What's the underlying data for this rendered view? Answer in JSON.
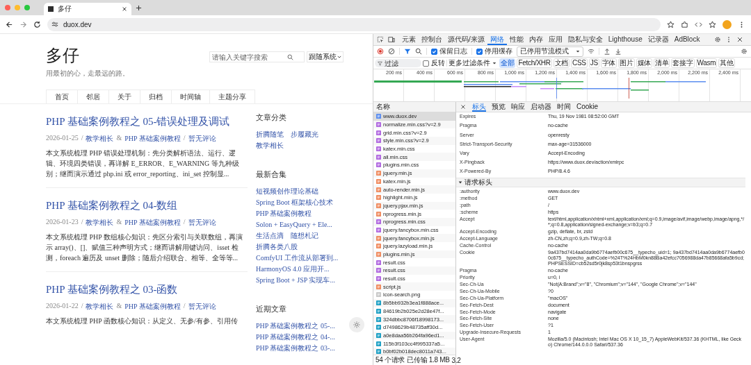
{
  "browser": {
    "tab_title": "多仔",
    "address": "duox.dev"
  },
  "page": {
    "site_title": "多仔",
    "tagline": "用最初的心，走最远的路。",
    "search": {
      "placeholder": "请输入关键字搜索"
    },
    "theme_select": "跟随系统",
    "nav": [
      {
        "label": "首页"
      },
      {
        "label": "邻居"
      },
      {
        "label": "关于"
      },
      {
        "label": "归档"
      },
      {
        "label": "时间轴"
      },
      {
        "label": "主题分享"
      }
    ],
    "meta_separator": "/",
    "category_joiner": "&",
    "posts": [
      {
        "title": "PHP 基础案例教程之 05-错误处理及调试",
        "date": "2026-01-25",
        "categories": [
          "教学相长",
          "PHP 基础案例教程"
        ],
        "comments": "暂无评论",
        "excerpt": "本文系统梳理 PHP 错误处理机制：先分类解析语法、运行、逻辑、环境四类错误，再详解 E_ERROR、E_WARNING 等九种级别；继而演示通过 php.ini 或 error_reporting、ini_set 控制显..."
      },
      {
        "title": "PHP 基础案例教程之 04-数组",
        "date": "2026-01-23",
        "categories": [
          "教学相长",
          "PHP 基础案例教程"
        ],
        "comments": "暂无评论",
        "excerpt": "本文系统梳理 PHP 数组核心知识：先区分索引与关联数组，再演示 array()、[]、赋值三种声明方式；继而讲解用键访问、isset 检测，foreach 遍历及 unset 删除；随后介绍联合、相等、全等等..."
      },
      {
        "title": "PHP 基础案例教程之 03-函数",
        "date": "2026-01-22",
        "categories": [
          "教学相长",
          "PHP 基础案例教程"
        ],
        "comments": "暂无评论",
        "excerpt": "本文系统梳理 PHP 函数核心知识：从定义、无参/有参、引用传"
      }
    ],
    "sidebar": [
      {
        "heading": "文章分类",
        "rows": [
          [
            "折腾随笔",
            "步履藏光"
          ],
          [
            "教学相长"
          ]
        ]
      },
      {
        "heading": "最新合集",
        "rows": [
          [
            "短视频创作理论基础"
          ],
          [
            "Spring Boot 框架核心技术"
          ],
          [
            "PHP 基础案例教程"
          ],
          [
            "Solon + EasyQuery + Ele..."
          ],
          [
            "生活点滴",
            "随想札记"
          ],
          [
            "折腾各类八股"
          ],
          [
            "ComfyUI 工作流从部署到..."
          ],
          [
            "HarmonyOS 4.0 应用开..."
          ],
          [
            "Spring Boot + JSP 实现车..."
          ]
        ]
      },
      {
        "heading": "近期文章",
        "rows": [
          [
            "PHP 基础案例教程之 05-..."
          ],
          [
            "PHP 基础案例教程之 04-..."
          ],
          [
            "PHP 基础案例教程之 03-..."
          ]
        ]
      }
    ]
  },
  "devtools": {
    "panels": [
      {
        "label": "元素",
        "selected": false
      },
      {
        "label": "控制台",
        "selected": false
      },
      {
        "label": "源代码/来源",
        "selected": false
      },
      {
        "label": "网络",
        "selected": true
      },
      {
        "label": "性能",
        "selected": false
      },
      {
        "label": "内存",
        "selected": false
      },
      {
        "label": "应用",
        "selected": false
      },
      {
        "label": "隐私与安全",
        "selected": false
      },
      {
        "label": "Lighthouse",
        "selected": false
      },
      {
        "label": "记录器",
        "selected": false
      },
      {
        "label": "AdBlock",
        "selected": false
      }
    ],
    "toolbar": {
      "preserve_log": {
        "label": "保留日志",
        "checked": true
      },
      "disable_cache": {
        "label": "停用缓存",
        "checked": true
      },
      "throttle": "已停用节流模式"
    },
    "filter": {
      "placeholder": "过滤",
      "invert": {
        "label": "反转",
        "checked": false
      },
      "more_filters": "更多过滤条件",
      "types": [
        {
          "label": "全部",
          "selected": true
        },
        {
          "label": "Fetch/XHR",
          "selected": false
        },
        {
          "label": "文档",
          "selected": false
        },
        {
          "label": "CSS",
          "selected": false
        },
        {
          "label": "JS",
          "selected": false
        },
        {
          "label": "字体",
          "selected": false
        },
        {
          "label": "图片",
          "selected": false
        },
        {
          "label": "媒体",
          "selected": false
        },
        {
          "label": "清单",
          "selected": false
        },
        {
          "label": "套接字",
          "selected": false
        },
        {
          "label": "Wasm",
          "selected": false
        },
        {
          "label": "其他",
          "selected": false
        }
      ]
    },
    "timeline_ticks": [
      "200 ms",
      "400 ms",
      "600 ms",
      "800 ms",
      "1,000 ms",
      "1,200 ms",
      "1,400 ms",
      "1,600 ms",
      "1,800 ms",
      "2,000 ms",
      "2,200 ms",
      "2,400 ms"
    ],
    "requests": {
      "header": "名称",
      "items": [
        {
          "name": "www.duox.dev",
          "kind": "document",
          "selected": true
        },
        {
          "name": "normalize.min.css?v=2.9",
          "kind": "stylesheet",
          "selected": false
        },
        {
          "name": "grid.min.css?v=2.9",
          "kind": "stylesheet",
          "selected": false
        },
        {
          "name": "style.min.css?v=2.9",
          "kind": "stylesheet",
          "selected": false
        },
        {
          "name": "katex.min.css",
          "kind": "stylesheet",
          "selected": false
        },
        {
          "name": "all.min.css",
          "kind": "stylesheet",
          "selected": false
        },
        {
          "name": "plugins.min.css",
          "kind": "stylesheet",
          "selected": false
        },
        {
          "name": "jquery.min.js",
          "kind": "script",
          "selected": false
        },
        {
          "name": "katex.min.js",
          "kind": "script",
          "selected": false
        },
        {
          "name": "auto-render.min.js",
          "kind": "script",
          "selected": false
        },
        {
          "name": "highlight.min.js",
          "kind": "script",
          "selected": false
        },
        {
          "name": "jquery.pjax.min.js",
          "kind": "script",
          "selected": false
        },
        {
          "name": "nprogress.min.js",
          "kind": "script",
          "selected": false
        },
        {
          "name": "nprogress.min.css",
          "kind": "stylesheet",
          "selected": false
        },
        {
          "name": "jquery.fancybox.min.css",
          "kind": "stylesheet",
          "selected": false
        },
        {
          "name": "jquery.fancybox.min.js",
          "kind": "script",
          "selected": false
        },
        {
          "name": "jquery.lazyload.min.js",
          "kind": "script",
          "selected": false
        },
        {
          "name": "plugins.min.js",
          "kind": "script",
          "selected": false
        },
        {
          "name": "result.css",
          "kind": "stylesheet",
          "selected": false
        },
        {
          "name": "result.css",
          "kind": "stylesheet",
          "selected": false
        },
        {
          "name": "result.css",
          "kind": "stylesheet",
          "selected": false
        },
        {
          "name": "script.js",
          "kind": "script",
          "selected": false
        },
        {
          "name": "icon-search.png",
          "kind": "image",
          "selected": false
        },
        {
          "name": "8b5bb932b3ea1f888ace...",
          "kind": "font",
          "selected": false
        },
        {
          "name": "84619b2b025e2d28e47f...",
          "kind": "font",
          "selected": false
        },
        {
          "name": "324dbbc8706f18998173...",
          "kind": "font",
          "selected": false
        },
        {
          "name": "d7498629b48735aff30d...",
          "kind": "font",
          "selected": false
        },
        {
          "name": "a0e8daa56b264fa96ed1...",
          "kind": "font",
          "selected": false
        },
        {
          "name": "115b3f103cc4f995337a5...",
          "kind": "font",
          "selected": false
        },
        {
          "name": "b0bf02b018dec8011a743...",
          "kind": "font",
          "selected": false
        }
      ]
    },
    "summary": [
      "54 个请求",
      "已传输 1.8 MB",
      "3.2"
    ],
    "detail": {
      "tabs": [
        {
          "label": "标头",
          "selected": true
        },
        {
          "label": "预览",
          "selected": false
        },
        {
          "label": "响应",
          "selected": false
        },
        {
          "label": "启动器",
          "selected": false
        },
        {
          "label": "时间",
          "selected": false
        },
        {
          "label": "Cookie",
          "selected": false
        }
      ],
      "response_headers": [
        {
          "name": "Expires",
          "value": "Thu, 19 Nov 1981 08:52:00 GMT"
        },
        {
          "name": "Pragma",
          "value": "no-cache"
        },
        {
          "name": "Server",
          "value": "openresty"
        },
        {
          "name": "Strict-Transport-Security",
          "value": "max-age=31536000"
        },
        {
          "name": "Vary",
          "value": "Accept-Encoding"
        },
        {
          "name": "X-Pingback",
          "value": "https://www.duox.dev/action/xmlrpc"
        },
        {
          "name": "X-Powered-By",
          "value": "PHP/8.4.6"
        }
      ],
      "request_section": {
        "title": "请求标头",
        "expanded": true
      },
      "request_headers": [
        {
          "name": ":authority",
          "value": "www.duox.dev"
        },
        {
          "name": ":method",
          "value": "GET"
        },
        {
          "name": ":path",
          "value": "/"
        },
        {
          "name": ":scheme",
          "value": "https"
        },
        {
          "name": "Accept",
          "value": "text/html,application/xhtml+xml,application/xml;q=0.9,image/avif,image/webp,image/apng,*/*;q=0.8,application/signed-exchange;v=b3;q=0.7"
        },
        {
          "name": "Accept-Encoding",
          "value": "gzip, deflate, br, zstd"
        },
        {
          "name": "Accept-Language",
          "value": "zh-CN,zh;q=0.9,zh-TW;q=0.8"
        },
        {
          "name": "Cache-Control",
          "value": "no-cache"
        },
        {
          "name": "Cookie",
          "value": "9a437bd7414aa0da9b6774aefb00c675__typecho_uid=1; 9a437bd7414aa0da9b6774aefb00c675__typecho_authCode=%24T%24HbM0kn88Ba42efcc7056988da47b85668afa5b9cd; PHPSESSID=cb52sd5r0jk8sp53t1bnspgrss"
        },
        {
          "name": "Pragma",
          "value": "no-cache"
        },
        {
          "name": "Priority",
          "value": "u=0, i"
        },
        {
          "name": "Sec-Ch-Ua",
          "value": "\"Not(A:Brand\";v=\"8\", \"Chromium\";v=\"144\", \"Google Chrome\";v=\"144\""
        },
        {
          "name": "Sec-Ch-Ua-Mobile",
          "value": "?0"
        },
        {
          "name": "Sec-Ch-Ua-Platform",
          "value": "\"macOS\""
        },
        {
          "name": "Sec-Fetch-Dest",
          "value": "document"
        },
        {
          "name": "Sec-Fetch-Mode",
          "value": "navigate"
        },
        {
          "name": "Sec-Fetch-Site",
          "value": "none"
        },
        {
          "name": "Sec-Fetch-User",
          "value": "?1"
        },
        {
          "name": "Upgrade-Insecure-Requests",
          "value": "1"
        },
        {
          "name": "User-Agent",
          "value": "Mozilla/5.0 (Macintosh; Intel Mac OS X 10_15_7) AppleWebKit/537.36 (KHTML, like Gecko) Chrome/144.0.0.0 Safari/537.36"
        }
      ]
    }
  }
}
